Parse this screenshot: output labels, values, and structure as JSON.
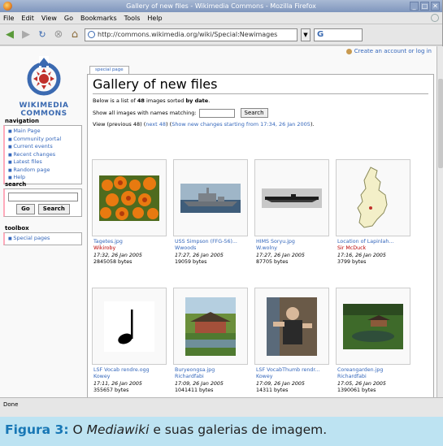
{
  "window": {
    "title": "Gallery of new files - Wikimedia Commons - Mozilla Firefox",
    "controls": [
      "_",
      "□",
      "✕"
    ]
  },
  "menu": [
    "File",
    "Edit",
    "View",
    "Go",
    "Bookmarks",
    "Tools",
    "Help"
  ],
  "nav": {
    "url": "http://commons.wikimedia.org/wiki/Special:Newimages",
    "search_icon_text": "G"
  },
  "personal": {
    "create_account": "Create an account or log in"
  },
  "logo": {
    "line1": "WIKIMEDIA",
    "line2": "COMMONS",
    "colors": {
      "red": "#c0302b",
      "blue": "#3b6ab1"
    }
  },
  "sidebar": {
    "navigation_title": "navigation",
    "navigation_items": [
      "Main Page",
      "Community portal",
      "Current events",
      "Recent changes",
      "Latest files",
      "Random page",
      "Help"
    ],
    "search_title": "search",
    "go_label": "Go",
    "search_label": "Search",
    "toolbox_title": "toolbox",
    "toolbox_items": [
      "Special pages"
    ]
  },
  "tab": {
    "special_page": "special page"
  },
  "main": {
    "title": "Gallery of new files",
    "intro_prefix": "Below is a list of ",
    "intro_count": "48",
    "intro_mid": " images sorted ",
    "intro_bold": "by date",
    "intro_suffix": ".",
    "match_label": "Show all images with names matching:",
    "match_button": "Search",
    "view_prefix": "View (previous 48) (",
    "view_next": "next 48",
    "view_mid": ") (",
    "view_show_new": "Show new changes starting from 17:34, 26 Jan 2005",
    "view_suffix": ")."
  },
  "gallery": [
    {
      "file": "Tagetes.jpg",
      "user": "Wikiroby",
      "user_red": true,
      "time": "17:32, 26 Jan 2005",
      "size": "2845058 bytes",
      "thumb": "flowers"
    },
    {
      "file": "USS Simpson (FFG-56)...",
      "user": "Wwoods",
      "user_red": false,
      "time": "17:27, 26 Jan 2005",
      "size": "19059 bytes",
      "thumb": "ship"
    },
    {
      "file": "HIMS Soryu.jpg",
      "user": "W.wolny",
      "user_red": false,
      "time": "17:27, 26 Jan 2005",
      "size": "87705 bytes",
      "thumb": "carrier"
    },
    {
      "file": "Location of Lapinlah...",
      "user": "Sir McDuck",
      "user_red": true,
      "time": "17:16, 26 Jan 2005",
      "size": "3799 bytes",
      "thumb": "map"
    },
    {
      "file": "LSF Vocab rendre.ogg",
      "user": "Kowey",
      "user_red": false,
      "time": "17:11, 26 Jan 2005",
      "size": "355657 bytes",
      "thumb": "note"
    },
    {
      "file": "Buryeongsa.jpg",
      "user": "Richardfabi",
      "user_red": false,
      "time": "17:09, 26 Jan 2005",
      "size": "1041411 bytes",
      "thumb": "temple"
    },
    {
      "file": "LSF VocabThumb rendr...",
      "user": "Kowey",
      "user_red": false,
      "time": "17:09, 26 Jan 2005",
      "size": "14311 bytes",
      "thumb": "person"
    },
    {
      "file": "Coreangarden.jpg",
      "user": "Richardfabi",
      "user_red": false,
      "time": "17:05, 26 Jan 2005",
      "size": "1390061 bytes",
      "thumb": "garden"
    }
  ],
  "status": {
    "text": "Done"
  },
  "figure_caption": {
    "label": "Figura 3:",
    "prefix": " O ",
    "emph": "Mediawiki",
    "rest": " e suas galerias de imagem."
  }
}
